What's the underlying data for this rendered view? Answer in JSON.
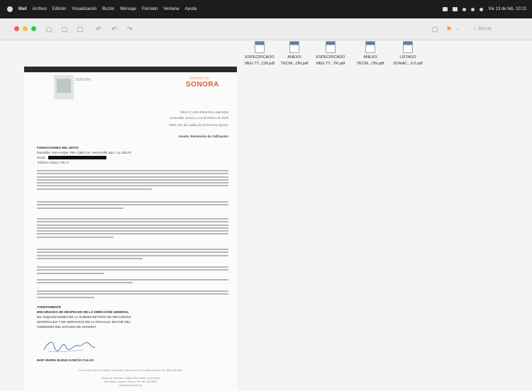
{
  "menubar": {
    "items": [
      "Mail",
      "Archivo",
      "Edición",
      "Visualización",
      "Buzón",
      "Mensaje",
      "Formato",
      "Ventana",
      "Ayuda"
    ],
    "clock": "Vie 13 de feb. 10:13"
  },
  "toolbar": {
    "search_placeholder": "Buscar"
  },
  "desktop_files": [
    {
      "name": "ESPECIFICADO",
      "sub": "NEG TT...CM.pdf"
    },
    {
      "name": "ANEXO",
      "sub": "TECNI...ON.pdf"
    },
    {
      "name": "ESPECIFICADO",
      "sub": "NEG TT...TR.pdf"
    },
    {
      "name": "ANEXO",
      "sub": "TECNI...ON.pdf"
    },
    {
      "name": "LISTADO",
      "sub": "DONAC...0.0.pdf"
    }
  ],
  "document": {
    "logo_left_text": "SONORA",
    "logo_right_tag": "Gobierno de",
    "logo_right_name": "SONORA",
    "office_no": "Oficio N°-DIR-SRMS-RGA-468-2025",
    "place_date": "Hermosillo, Sonora, a 13 de febrero de 2025",
    "year_motto": "\"2025: Año del Jubileo de la Reforma Agraria\"",
    "subject": "Asunto: Resolución de Calificación",
    "recipient": "FUNDACIONES DEL MAYO",
    "address": "Domicilio: Asís-Arizpe, Pte. Calle Col. Hermosillo Son. c.p. 83170",
    "email_label": "Email:",
    "phone": "Teléfono: (662) 1-59-17",
    "attentive": "ATENTAMENTE",
    "sign_title_1": "ENCARGADA DE DESPACHO DE LA DIRECCIÓN GENERAL",
    "sign_title_2": "DE ADQUISICIONES DE LA SUBSECRETARÍA DE RECURSOS",
    "sign_title_3": "MATERIALES Y DE SERVICIOS DE LA OFICIALÍA MAYOR DEL",
    "sign_title_4": "GOBIERNO DEL ESTADO DE SONORA",
    "signer": "MAP. MARÍA ELENA GARCÍA CALAS",
    "footer_1": "Centro de Gobierno, Edificio Hermosillo, tercer nivel, Hermosillo, Sonora, Tel. 662-108-5000",
    "footer_2": "Centro de Gobierno, Edificio Hermosillo, tercer nivel",
    "footer_3": "Hermosillo, Sonora, México. Tel. 662 108 5000",
    "footer_4": "www.sonora.gob.mx"
  },
  "colors": {
    "menubar_bg": "#1c1c1e",
    "toolbar_bg": "#ececec",
    "logo_orange": "#e05a3a"
  }
}
